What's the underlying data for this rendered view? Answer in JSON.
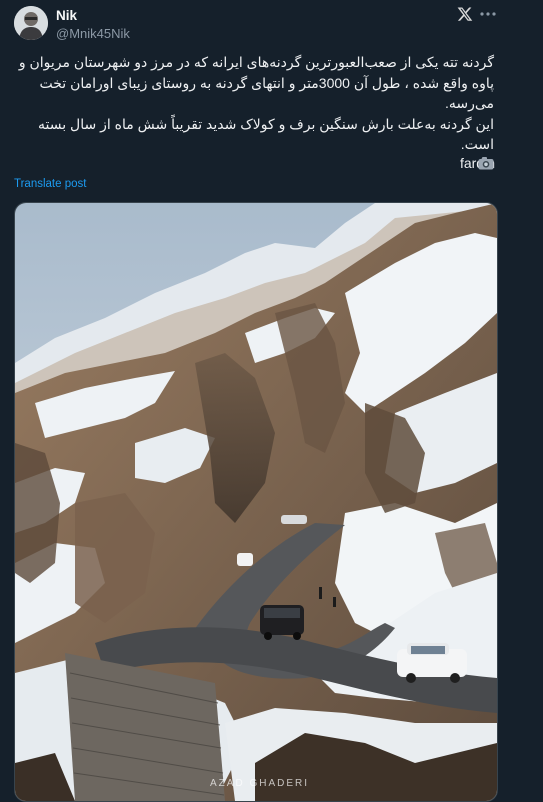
{
  "author": {
    "display_name": "Nik",
    "handle": "@Mnik45Nik"
  },
  "icons": {
    "platform": "x-logo-icon",
    "more": "more-options-icon",
    "camera": "camera-icon"
  },
  "tweet": {
    "lines": [
      "گردنه تته یکی از صعب‌العبورترین گردنه‌های ایرانه که در مرز دو شهرستان مریوان و",
      "پاوه واقع شده ، طول آن 3000متر و انتهای گردنه به روستای زیبای اورامان تخت",
      "می‌رسه.",
      "این گردنه به‌علت بارش سنگین برف و کولاک شدید تقریباً شش ماه از سال بسته",
      "است."
    ],
    "signature": "fardin",
    "translate_label": "Translate post"
  },
  "media": {
    "watermark": "AZAD GHADERI",
    "colors": {
      "sky": "#c9d4e0",
      "snow": "#eef2f5",
      "rock": "#8a7058",
      "road": "#46484a"
    }
  },
  "colors": {
    "background": "#15202b",
    "accent": "#1d9bf0",
    "muted": "#8b98a5"
  }
}
